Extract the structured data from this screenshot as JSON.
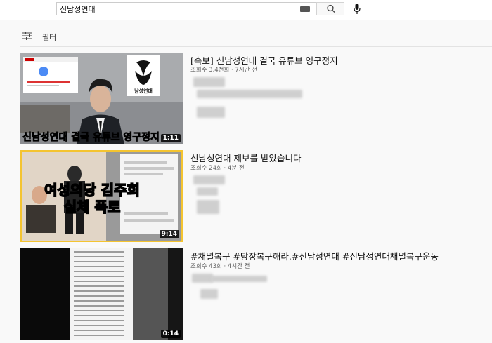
{
  "search": {
    "value": "신남성연대"
  },
  "filter": {
    "label": "필터"
  },
  "results": [
    {
      "title": "[속보] 신남성연대 결국 유튜브 영구정지",
      "views": "조회수 3.4천회",
      "age": "7시간 전",
      "duration": "1:11",
      "thumb_caption": "신남성연대 결국 유튜브 영구정지",
      "logo_text": "남성연대"
    },
    {
      "title": "신남성연대 제보를 받았습니다",
      "views": "조회수 24회",
      "age": "4분 전",
      "duration": "9:14",
      "thumb_line1": "여성의당 김주희",
      "thumb_line2": "실체 폭로"
    },
    {
      "title": "#채널복구 #당장복구해라.#신남성연대 #신남성연대채널복구운동",
      "views": "조회수 43회",
      "age": "4시간 전",
      "duration": "0:14"
    }
  ],
  "colors": {
    "accent_red": "#cc0000",
    "thumb_border_yellow": "#f4c430",
    "caption_yellow": "#ffe033"
  }
}
